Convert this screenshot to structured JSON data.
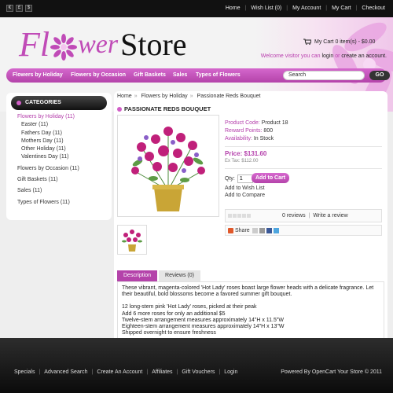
{
  "topbar": {
    "currencies": [
      "€",
      "£",
      "$"
    ],
    "links": [
      "Home",
      "Wish List (0)",
      "My Account",
      "My Cart",
      "Checkout"
    ]
  },
  "header": {
    "logo_part1": "Fl",
    "logo_part2": "wer",
    "logo_part3": "Store",
    "cart_text": "My Cart 0 item(s) - $0.00",
    "welcome_prefix": "Welcome visitor you can",
    "login": "login",
    "or": "or",
    "create_account": "create an account."
  },
  "nav": {
    "items": [
      "Flowers by Holiday",
      "Flowers by Occasion",
      "Gift Baskets",
      "Sales",
      "Types of Flowers"
    ],
    "search_value": "Search",
    "go_label": "GO"
  },
  "sidebar": {
    "heading": "CATEGORIES",
    "items": [
      {
        "label": "Flowers by Holiday (11)",
        "active": true
      },
      {
        "label": "Easter (11)",
        "sub": true
      },
      {
        "label": "Fathers Day (11)",
        "sub": true
      },
      {
        "label": "Mothers Day (11)",
        "sub": true
      },
      {
        "label": "Other Holiday (11)",
        "sub": true
      },
      {
        "label": "Valentines Day (11)",
        "sub": true
      },
      {
        "label": "Flowers by Occasion (11)"
      },
      {
        "label": "Gift Baskets (11)"
      },
      {
        "label": "Sales (11)"
      },
      {
        "label": "Types of Flowers (11)"
      }
    ]
  },
  "breadcrumb": [
    "Home",
    "Flowers by Holiday",
    "Passionate Reds Bouquet"
  ],
  "product": {
    "title": "PASSIONATE REDS BOUQUET",
    "code_label": "Product Code:",
    "code_value": "Product 18",
    "points_label": "Reward Points:",
    "points_value": "800",
    "availability_label": "Availability:",
    "availability_value": "In Stock",
    "price": "Price: $131.60",
    "ex_tax": "Ex Tax: $112.00",
    "qty_label": "Qty:",
    "qty_value": "1",
    "add_to_cart": "Add to Cart",
    "add_to_wishlist": "Add to Wish List",
    "add_to_compare": "Add to Compare",
    "reviews_count": "0 reviews",
    "write_review": "Write a review",
    "share": "Share",
    "rating_stars": 0
  },
  "tabs": [
    "Description",
    "Reviews (0)"
  ],
  "description": {
    "intro": "These vibrant, magenta-colored 'Hot Lady' roses boast large flower heads with a delicate fragrance. Let their beautiful, bold blossoms become a favored summer gift bouquet.",
    "lines": [
      "12 long-stem pink 'Hot Lady' roses, picked at their peak",
      "Add 6 more roses for only an additional $5",
      "Twelve-stem arrangement measures approximately 14\"H x 11.5\"W",
      "Eighteen-stem arrangement measures approximately 14\"H x 13\"W",
      "Shipped overnight to ensure freshness"
    ]
  },
  "footer": {
    "links": [
      "Specials",
      "Advanced Search",
      "Create An Account",
      "Affiliates",
      "Gift Vouchers",
      "Login"
    ],
    "powered": "Powered By OpenCart Your Store © 2011"
  },
  "colors": {
    "accent": "#b443aa",
    "dark": "#111111"
  }
}
